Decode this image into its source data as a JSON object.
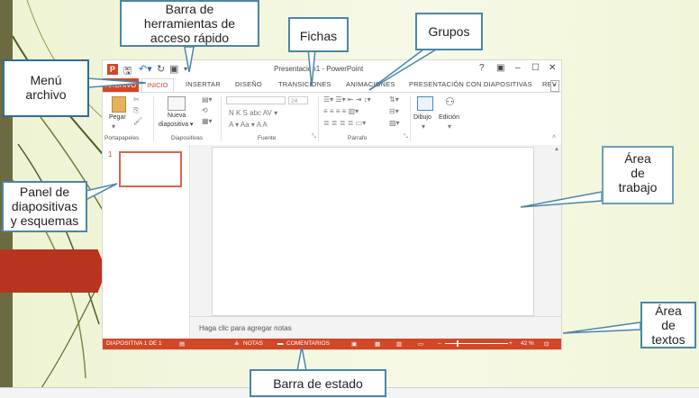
{
  "app": {
    "title": "Presentación1 - PowerPoint",
    "logo": "P",
    "window_buttons": [
      "?",
      "▣",
      "–",
      "☐",
      "✕"
    ]
  },
  "tabs": {
    "archivo": "ARCHIVO",
    "inicio": "INICIO",
    "others": [
      "INSERTAR",
      "DISEÑO",
      "TRANSICIONES",
      "ANIMACIONES",
      "PRESENTACIÓN CON DIAPOSITIVAS",
      "REV"
    ]
  },
  "ribbon": {
    "paste_label": "Pegar",
    "new_slide_label_1": "Nueva",
    "new_slide_label_2": "diapositiva ▾",
    "font_size": "24",
    "draw_label": "Dibujo",
    "edit_label": "Edición",
    "groups": [
      "Portapapeles",
      "Diapositivas",
      "Fuente",
      "Párrafo"
    ],
    "font_buttons": "N  K  S  abc  AV ▾",
    "font_buttons2": "A ▾  Aa ▾  A  A"
  },
  "thumbnail": {
    "number": "1"
  },
  "notes": {
    "placeholder": "Haga clic para agregar notas"
  },
  "status": {
    "slide": "DIAPOSITIVA 1 DE 1",
    "notas": "NOTAS",
    "comentarios": "COMENTARIOS",
    "zoom": "42 %"
  },
  "callouts": {
    "qat": [
      "Barra de",
      "herramientas de",
      "acceso rápido"
    ],
    "fichas": "Fichas",
    "grupos": "Grupos",
    "menu": [
      "Menú",
      "archivo"
    ],
    "panel": [
      "Panel de",
      "diapositivas",
      "y esquemas"
    ],
    "area_trabajo": [
      "Área",
      "de",
      "trabajo"
    ],
    "area_textos": [
      "Área",
      "de",
      "textos"
    ],
    "barra_estado": "Barra de estado"
  },
  "colors": {
    "accent": "#d24726",
    "callout_border": "#4a86a8"
  }
}
